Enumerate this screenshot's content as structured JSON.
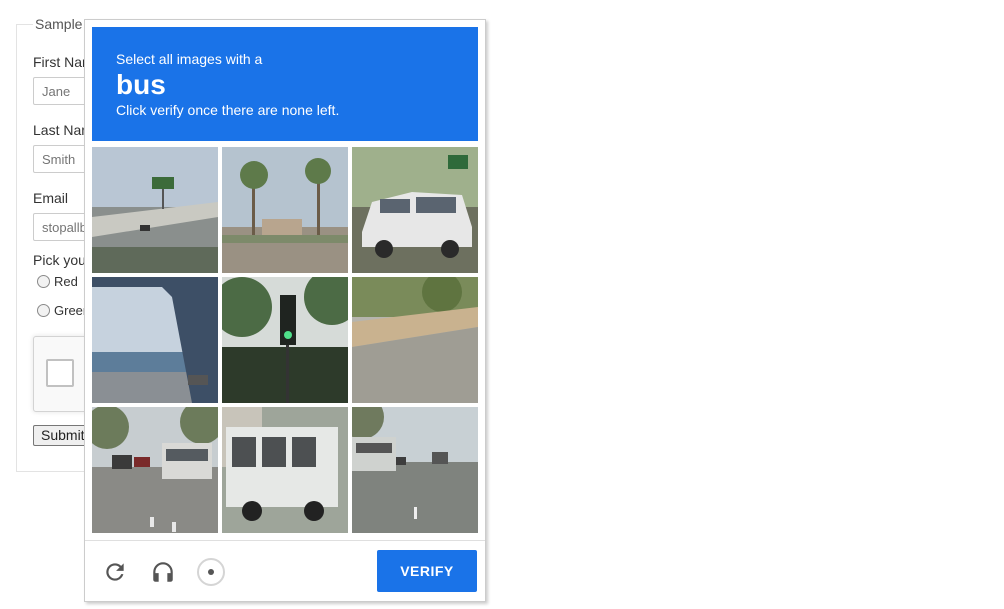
{
  "form": {
    "legend": "Sample Form with ReCAPTCHA",
    "first_name_label": "First Name",
    "first_name_placeholder": "Jane",
    "last_name_label": "Last Name",
    "last_name_placeholder": "Smith",
    "email_label": "Email",
    "email_placeholder": "stopallbots@gmail.com",
    "color_prompt": "Pick your favorite color:",
    "colors": [
      "Red",
      "Green"
    ],
    "submit_label": "Submit"
  },
  "challenge": {
    "instruction": "Select all images with a",
    "keyword": "bus",
    "sub_instruction": "Click verify once there are none left.",
    "verify_label": "VERIFY",
    "tiles": [
      {
        "scene": "highway overpass with green sign",
        "palette": [
          "#b9c6d4",
          "#8a8f8d",
          "#5f6a5a"
        ]
      },
      {
        "scene": "palm trees and parked trailer",
        "palette": [
          "#b5c3cf",
          "#7d8a6a",
          "#9a9183"
        ]
      },
      {
        "scene": "white minivan on road",
        "palette": [
          "#9fb08c",
          "#e7e7e7",
          "#6d705f"
        ]
      },
      {
        "scene": "bridge structure over water",
        "palette": [
          "#c6d2de",
          "#3d4f66",
          "#8a8f94"
        ]
      },
      {
        "scene": "traffic light in trees",
        "palette": [
          "#d6dbd8",
          "#4c6b45",
          "#2d3a2a"
        ]
      },
      {
        "scene": "empty road with curb",
        "palette": [
          "#7a8b5a",
          "#b6b5ae",
          "#9f9d94"
        ]
      },
      {
        "scene": "street with parked cars and bus",
        "palette": [
          "#c7cdd0",
          "#8a8a86",
          "#6c7b5b"
        ]
      },
      {
        "scene": "side of white bus",
        "palette": [
          "#9ea59a",
          "#e6e8e6",
          "#4d5052"
        ]
      },
      {
        "scene": "city street with bus",
        "palette": [
          "#c8d0d4",
          "#7f837e",
          "#cfd2cf"
        ]
      }
    ],
    "footer_icons": [
      "reload-icon",
      "audio-icon",
      "info-icon"
    ],
    "accent_color": "#1a73e8"
  }
}
